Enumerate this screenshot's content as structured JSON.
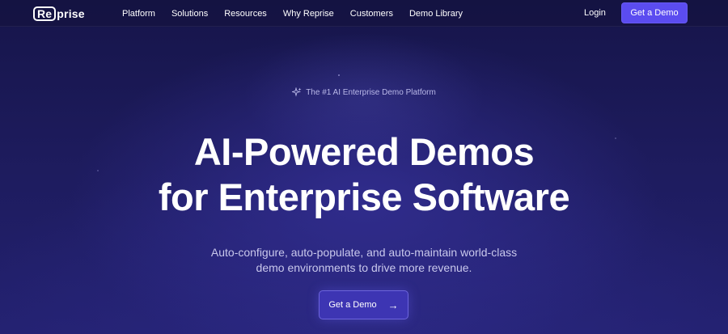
{
  "brand": {
    "logo_boxed": "Re",
    "logo_rest": "prise"
  },
  "nav": {
    "items": [
      {
        "label": "Platform"
      },
      {
        "label": "Solutions"
      },
      {
        "label": "Resources"
      },
      {
        "label": "Why Reprise"
      },
      {
        "label": "Customers"
      },
      {
        "label": "Demo Library"
      }
    ],
    "login_label": "Login",
    "cta_label": "Get a Demo"
  },
  "hero": {
    "eyebrow": "The #1 AI Enterprise Demo Platform",
    "eyebrow_icon": "sparkle-icon",
    "headline_line1": "AI-Powered Demos",
    "headline_line2": "for Enterprise Software",
    "subtext_line1": "Auto-configure, auto-populate, and auto-maintain world-class",
    "subtext_line2": "demo environments to drive more revenue.",
    "cta_label": "Get a Demo",
    "cta_icon": "arrow-right-icon"
  },
  "colors": {
    "background": "#1d1b5c",
    "accent": "#5b4cf0",
    "cta_secondary": "#3d35b3",
    "text_primary": "#ffffff",
    "text_muted": "#c9c8ec"
  }
}
